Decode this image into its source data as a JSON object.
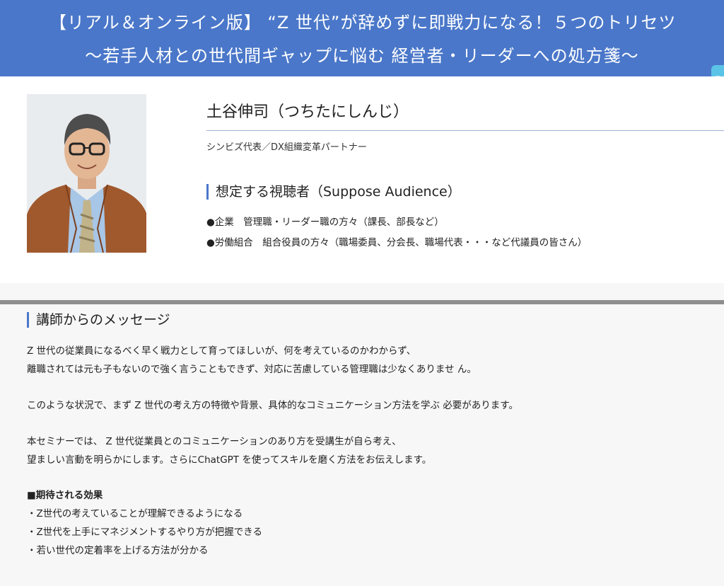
{
  "header": {
    "line1": "【リアル＆オンライン版】 “Z 世代”が辞めずに即戦力になる！５つのトリセツ",
    "line2": "～若手人材との世代間ギャップに悩む 経営者・リーダーへの処方箋～"
  },
  "side_tab_icon": "phone-icon",
  "speaker": {
    "name": "土谷伸司（つちたにしんじ）",
    "title": "シンビズ代表／DX組織変革パートナー"
  },
  "audience": {
    "heading": "想定する視聴者（Suppose Audience）",
    "items": [
      "●企業　管理職・リーダー職の方々（課長、部長など）",
      "●労働組合　組合役員の方々（職場委員、分会長、職場代表・・・など代議員の皆さん）"
    ]
  },
  "message": {
    "heading": "講師からのメッセージ",
    "p1": [
      "Z 世代の従業員になるべく早く戦力として育ってほしいが、何を考えているのかわからず、",
      "離職されては元も子もないので強く言うこともできず、対応に苦慮している管理職は少なくありませ ん。"
    ],
    "p2": "このような状況で、まず Z 世代の考え方の特徴や背景、具体的なコミュニケーション方法を学ぶ 必要があります。",
    "p3": [
      "本セミナーでは、 Z 世代従業員とのコミュニケーションのあり方を受講生が自ら考え、",
      "望ましい言動を明らかにします。さらにChatGPT を使ってスキルを磨く方法をお伝えします。"
    ],
    "effects_heading": "■期待される効果",
    "effects": [
      "・Z世代の考えていることが理解できるようになる",
      "・Z世代を上手にマネジメントするやり方が把握できる",
      "・若い世代の定着率を上げる方法が分かる"
    ]
  }
}
